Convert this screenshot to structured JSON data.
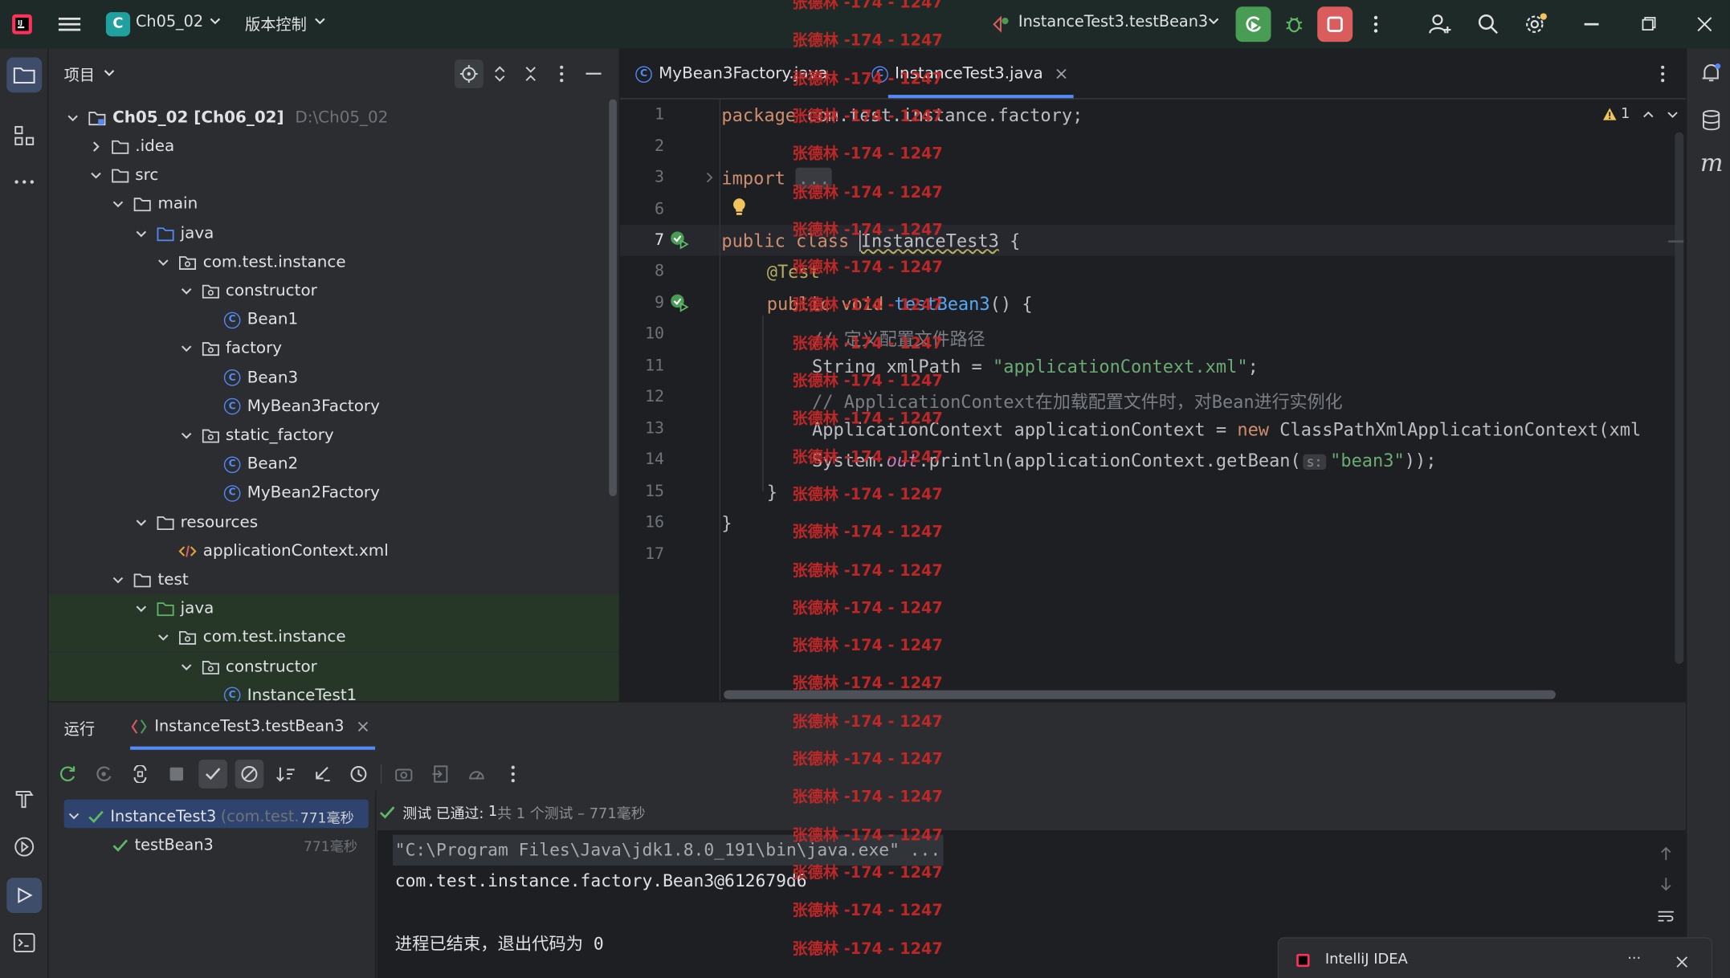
{
  "title_bar": {
    "project_badge": "C",
    "project_name": "Ch05_02",
    "vcs_menu": "版本控制",
    "run_config": "InstanceTest3.testBean3"
  },
  "project_panel": {
    "title": "项目",
    "root_name": "Ch05_02 [Ch06_02]",
    "root_path": "D:\\Ch05_02",
    "items": [
      {
        "label": ".idea",
        "depth": 1,
        "type": "folder",
        "open": false
      },
      {
        "label": "src",
        "depth": 1,
        "type": "folder",
        "open": true
      },
      {
        "label": "main",
        "depth": 2,
        "type": "folder",
        "open": true
      },
      {
        "label": "java",
        "depth": 3,
        "type": "srcfolder",
        "open": true
      },
      {
        "label": "com.test.instance",
        "depth": 4,
        "type": "package",
        "open": true
      },
      {
        "label": "constructor",
        "depth": 5,
        "type": "package",
        "open": true
      },
      {
        "label": "Bean1",
        "depth": 6,
        "type": "class"
      },
      {
        "label": "factory",
        "depth": 5,
        "type": "package",
        "open": true
      },
      {
        "label": "Bean3",
        "depth": 6,
        "type": "class"
      },
      {
        "label": "MyBean3Factory",
        "depth": 6,
        "type": "class"
      },
      {
        "label": "static_factory",
        "depth": 5,
        "type": "package",
        "open": true
      },
      {
        "label": "Bean2",
        "depth": 6,
        "type": "class"
      },
      {
        "label": "MyBean2Factory",
        "depth": 6,
        "type": "class"
      },
      {
        "label": "resources",
        "depth": 3,
        "type": "resfolder",
        "open": true
      },
      {
        "label": "applicationContext.xml",
        "depth": 4,
        "type": "xml"
      },
      {
        "label": "test",
        "depth": 2,
        "type": "folder",
        "open": true
      },
      {
        "label": "java",
        "depth": 3,
        "type": "testfolder",
        "open": true,
        "highlight": true
      },
      {
        "label": "com.test.instance",
        "depth": 4,
        "type": "package",
        "open": true,
        "highlight": true
      },
      {
        "label": "constructor",
        "depth": 5,
        "type": "package",
        "open": true,
        "highlight": true
      },
      {
        "label": "InstanceTest1",
        "depth": 6,
        "type": "class",
        "highlight": true
      }
    ]
  },
  "editor": {
    "tabs": [
      {
        "label": "MyBean3Factory.java",
        "active": false
      },
      {
        "label": "InstanceTest3.java",
        "active": true
      }
    ],
    "warning_count": "1",
    "line_numbers": [
      "1",
      "2",
      "3",
      "6",
      "7",
      "8",
      "9",
      "10",
      "11",
      "12",
      "13",
      "14",
      "15",
      "16",
      "17"
    ],
    "code": {
      "l1_kw": "package",
      "l1_rest": " com.test.instance.factory;",
      "l3_kw": "import",
      "l3_fold": "...",
      "l7_kw": "public class",
      "l7_name": "InstanceTest3",
      "l7_rest": " {",
      "l8_ann": "@Test",
      "l9_kw": "public void",
      "l9_fn": "testBean3",
      "l9_rest": "() {",
      "l10_cmt": "// 定义配置文件路径",
      "l11_pre": "String xmlPath = ",
      "l11_str": "\"applicationContext.xml\"",
      "l11_post": ";",
      "l12_cmt": "// ApplicationContext在加载配置文件时，对Bean进行实例化",
      "l13_pre": "ApplicationContext applicationContext = ",
      "l13_kw": "new",
      "l13_post": " ClassPathXmlApplicationContext(xml",
      "l14_pre": "System.",
      "l14_it": "out",
      "l14_mid": ".println(applicationContext.getBean(",
      "l14_hint": "s:",
      "l14_str": "\"bean3\"",
      "l14_post": "));",
      "l15": "}",
      "l16": "}"
    }
  },
  "run_panel": {
    "title": "运行",
    "tab_label": "InstanceTest3.testBean3",
    "tree": [
      {
        "label": "InstanceTest3",
        "sub": "(com.test.ir",
        "time": "771毫秒"
      },
      {
        "label": "testBean3",
        "time": "771毫秒"
      }
    ],
    "status_prefix": "测试 已通过:",
    "status_count": "1",
    "status_suffix": "共 1 个测试 – 771毫秒",
    "console": [
      "\"C:\\Program Files\\Java\\jdk1.8.0_191\\bin\\java.exe\" ...",
      "com.test.instance.factory.Bean3@612679d6",
      "",
      "进程已结束，退出代码为 0"
    ]
  },
  "watermark": "张德林 -174 - 1247",
  "notification": {
    "title": "IntelliJ IDEA",
    "more": "···"
  },
  "colors": {
    "accent": "#548af7",
    "run_green": "#499c54",
    "stop_red": "#db5c5c",
    "watermark": "#c62828"
  }
}
